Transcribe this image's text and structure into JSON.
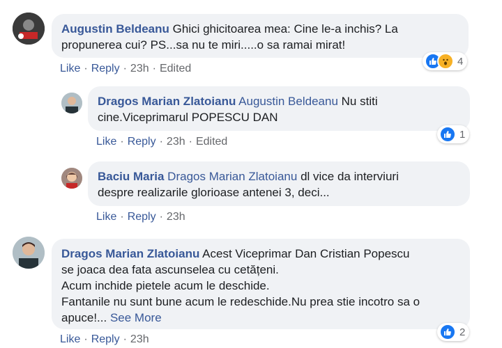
{
  "comments": [
    {
      "author": "Augustin Beldeanu",
      "mention": "",
      "text_lines": [
        "Ghici ghicitoarea mea: Cine le-a inchis? La",
        "propunerea cui? PS...sa nu te miri.....o sa ramai mirat!"
      ],
      "actions": {
        "like": "Like",
        "reply": "Reply",
        "time": "23h",
        "edited": "Edited"
      },
      "reaction_count": "4",
      "reaction_icons": [
        "like-icon",
        "wow-icon"
      ]
    },
    {
      "author": "Dragos Marian Zlatoianu",
      "mention": "Augustin Beldeanu",
      "text_lines": [
        "Nu stiti",
        "cine.Viceprimarul POPESCU DAN"
      ],
      "actions": {
        "like": "Like",
        "reply": "Reply",
        "time": "23h",
        "edited": "Edited"
      },
      "reaction_count": "1",
      "reaction_icons": [
        "like-icon"
      ]
    },
    {
      "author": "Baciu Maria",
      "mention": "Dragos Marian Zlatoianu",
      "text_lines": [
        "dl vice da interviuri",
        "despre realizarile glorioase antenei 3, deci..."
      ],
      "actions": {
        "like": "Like",
        "reply": "Reply",
        "time": "23h"
      }
    },
    {
      "author": "Dragos Marian Zlatoianu",
      "mention": "",
      "text_lines": [
        "Acest Viceprimar Dan Cristian Popescu",
        "se joaca dea fata ascunselea cu cetățeni.",
        "Acum inchide pietele acum le deschide.",
        "Fantanile nu sunt bune acum le redeschide.Nu prea stie incotro sa o",
        "apuce!..."
      ],
      "see_more": "See More",
      "actions": {
        "like": "Like",
        "reply": "Reply",
        "time": "23h"
      },
      "reaction_count": "2",
      "reaction_icons": [
        "like-icon"
      ]
    }
  ],
  "colors": {
    "link": "#385898",
    "bubble": "#f0f2f5",
    "like": "#1877f2",
    "wow": "#f7b125",
    "meta": "#65676b"
  }
}
